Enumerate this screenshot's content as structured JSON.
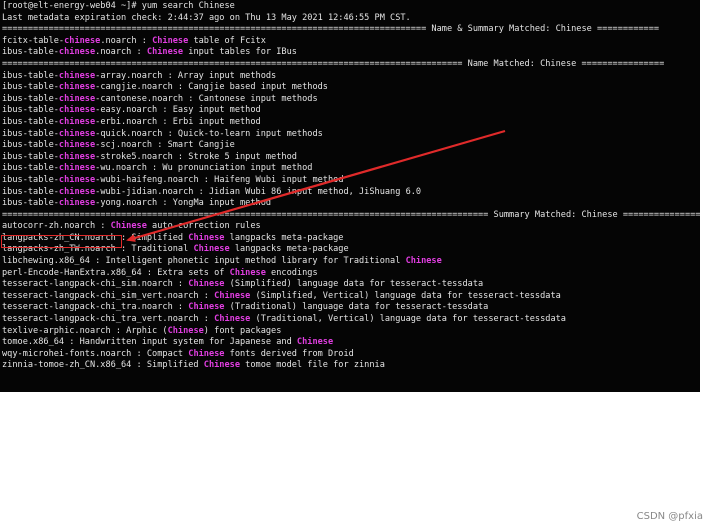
{
  "terminal": {
    "lines": [
      [
        {
          "t": "[root@elt-energy-web04 ~]# yum search Chinese"
        }
      ],
      [
        {
          "t": "Last metadata expiration check: 2:44:37 ago on Thu 13 May 2021 12:46:55 PM CST."
        }
      ],
      [
        {
          "t": "================================================================================== Name & Summary Matched: Chinese ============"
        }
      ],
      [
        {
          "t": "fcitx-table-"
        },
        {
          "t": "chinese",
          "h": true
        },
        {
          "t": ".noarch : "
        },
        {
          "t": "Chinese",
          "h": true
        },
        {
          "t": " table of Fcitx"
        }
      ],
      [
        {
          "t": "ibus-table-"
        },
        {
          "t": "chinese",
          "h": true
        },
        {
          "t": ".noarch : "
        },
        {
          "t": "Chinese",
          "h": true
        },
        {
          "t": " input tables for IBus"
        }
      ],
      [
        {
          "t": "========================================================================================= Name Matched: Chinese ================"
        }
      ],
      [
        {
          "t": "ibus-table-"
        },
        {
          "t": "chinese",
          "h": true
        },
        {
          "t": "-array.noarch : Array input methods"
        }
      ],
      [
        {
          "t": "ibus-table-"
        },
        {
          "t": "chinese",
          "h": true
        },
        {
          "t": "-cangjie.noarch : Cangjie based input methods"
        }
      ],
      [
        {
          "t": "ibus-table-"
        },
        {
          "t": "chinese",
          "h": true
        },
        {
          "t": "-cantonese.noarch : Cantonese input methods"
        }
      ],
      [
        {
          "t": "ibus-table-"
        },
        {
          "t": "chinese",
          "h": true
        },
        {
          "t": "-easy.noarch : Easy input method"
        }
      ],
      [
        {
          "t": "ibus-table-"
        },
        {
          "t": "chinese",
          "h": true
        },
        {
          "t": "-erbi.noarch : Erbi input method"
        }
      ],
      [
        {
          "t": "ibus-table-"
        },
        {
          "t": "chinese",
          "h": true
        },
        {
          "t": "-quick.noarch : Quick-to-learn input methods"
        }
      ],
      [
        {
          "t": "ibus-table-"
        },
        {
          "t": "chinese",
          "h": true
        },
        {
          "t": "-scj.noarch : Smart Cangjie"
        }
      ],
      [
        {
          "t": "ibus-table-"
        },
        {
          "t": "chinese",
          "h": true
        },
        {
          "t": "-stroke5.noarch : Stroke 5 input method"
        }
      ],
      [
        {
          "t": "ibus-table-"
        },
        {
          "t": "chinese",
          "h": true
        },
        {
          "t": "-wu.noarch : Wu pronunciation input method"
        }
      ],
      [
        {
          "t": "ibus-table-"
        },
        {
          "t": "chinese",
          "h": true
        },
        {
          "t": "-wubi-haifeng.noarch : Haifeng Wubi input method"
        }
      ],
      [
        {
          "t": "ibus-table-"
        },
        {
          "t": "chinese",
          "h": true
        },
        {
          "t": "-wubi-jidian.noarch : Jidian Wubi 86 input method, JiShuang 6.0"
        }
      ],
      [
        {
          "t": "ibus-table-"
        },
        {
          "t": "chinese",
          "h": true
        },
        {
          "t": "-yong.noarch : YongMa input method"
        }
      ],
      [
        {
          "t": "============================================================================================== Summary Matched: Chinese ==============="
        }
      ],
      [
        {
          "t": "autocorr-zh.noarch : "
        },
        {
          "t": "Chinese",
          "h": true
        },
        {
          "t": " auto-correction rules"
        }
      ],
      [
        {
          "t": "langpacks-zh_CN.noarch : Simplified "
        },
        {
          "t": "Chinese",
          "h": true
        },
        {
          "t": " langpacks meta-package"
        }
      ],
      [
        {
          "t": "langpacks-zh_TW.noarch : Traditional "
        },
        {
          "t": "Chinese",
          "h": true
        },
        {
          "t": " langpacks meta-package"
        }
      ],
      [
        {
          "t": "libchewing.x86_64 : Intelligent phonetic input method library for Traditional "
        },
        {
          "t": "Chinese",
          "h": true
        }
      ],
      [
        {
          "t": "perl-Encode-HanExtra.x86_64 : Extra sets of "
        },
        {
          "t": "Chinese",
          "h": true
        },
        {
          "t": " encodings"
        }
      ],
      [
        {
          "t": "tesseract-langpack-chi_sim.noarch : "
        },
        {
          "t": "Chinese",
          "h": true
        },
        {
          "t": " (Simplified) language data for tesseract-tessdata"
        }
      ],
      [
        {
          "t": "tesseract-langpack-chi_sim_vert.noarch : "
        },
        {
          "t": "Chinese",
          "h": true
        },
        {
          "t": " (Simplified, Vertical) language data for tesseract-tessdata"
        }
      ],
      [
        {
          "t": "tesseract-langpack-chi_tra.noarch : "
        },
        {
          "t": "Chinese",
          "h": true
        },
        {
          "t": " (Traditional) language data for tesseract-tessdata"
        }
      ],
      [
        {
          "t": "tesseract-langpack-chi_tra_vert.noarch : "
        },
        {
          "t": "Chinese",
          "h": true
        },
        {
          "t": " (Traditional, Vertical) language data for tesseract-tessdata"
        }
      ],
      [
        {
          "t": "texlive-arphic.noarch : Arphic ("
        },
        {
          "t": "Chinese",
          "h": true
        },
        {
          "t": ") font packages"
        }
      ],
      [
        {
          "t": "tomoe.x86_64 : Handwritten input system for Japanese and "
        },
        {
          "t": "Chinese",
          "h": true
        }
      ],
      [
        {
          "t": "wqy-microhei-fonts.noarch : Compact "
        },
        {
          "t": "Chinese",
          "h": true
        },
        {
          "t": " fonts derived from Droid"
        }
      ],
      [
        {
          "t": "zinnia-tomoe-zh_CN.x86_64 : Simplified "
        },
        {
          "t": "Chinese",
          "h": true
        },
        {
          "t": " tomoe model file for zinnia"
        }
      ]
    ]
  },
  "watermark": "CSDN @pfxia",
  "colors": {
    "terminal_bg": "#050505",
    "text": "#e4e4e4",
    "highlight": "#e03ee0",
    "annotation": "#e02a2a"
  }
}
